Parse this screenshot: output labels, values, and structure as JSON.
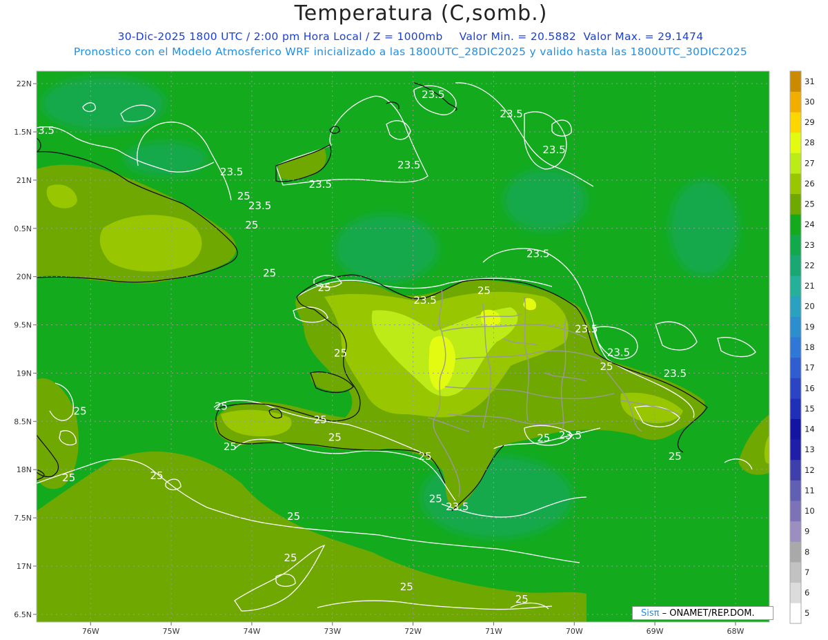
{
  "title": "Temperatura (C,somb.)",
  "subtitle": {
    "datetime": "30-Dic-2025  1800 UTC / 2:00 pm Hora Local / Z = 1000mb",
    "min": "Valor Min. = 20.5882",
    "max": "Valor Max. = 29.1474"
  },
  "subtitle2": "Pronostico con el Modelo Atmosferico WRF inicializado a las 1800UTC_28DIC2025 y valido hasta las  1800UTC_30DIC2025",
  "credit": {
    "brand": "Sisπ",
    "text": " – ONAMET/REP.DOM."
  },
  "map": {
    "lon_range": [
      -76.67,
      -67.58
    ],
    "lat_range": [
      16.42,
      22.13
    ],
    "lat_ticks": [
      {
        "v": 22.0,
        "label": "22N"
      },
      {
        "v": 21.5,
        "label": "1.5N"
      },
      {
        "v": 21.0,
        "label": "21N"
      },
      {
        "v": 20.5,
        "label": "0.5N"
      },
      {
        "v": 20.0,
        "label": "20N"
      },
      {
        "v": 19.5,
        "label": "9.5N"
      },
      {
        "v": 19.0,
        "label": "19N"
      },
      {
        "v": 18.5,
        "label": "8.5N"
      },
      {
        "v": 18.0,
        "label": "18N"
      },
      {
        "v": 17.5,
        "label": "7.5N"
      },
      {
        "v": 17.0,
        "label": "17N"
      },
      {
        "v": 16.5,
        "label": "6.5N"
      }
    ],
    "lon_ticks": [
      {
        "v": -76,
        "label": "76W"
      },
      {
        "v": -75,
        "label": "75W"
      },
      {
        "v": -74,
        "label": "74W"
      },
      {
        "v": -73,
        "label": "73W"
      },
      {
        "v": -72,
        "label": "72W"
      },
      {
        "v": -71,
        "label": "71W"
      },
      {
        "v": -70,
        "label": "70W"
      },
      {
        "v": -69,
        "label": "69W"
      },
      {
        "v": -68,
        "label": "68W"
      }
    ],
    "contour_labels": [
      {
        "lon": -76.55,
        "lat": 21.48,
        "t": "3.5"
      },
      {
        "lon": -74.25,
        "lat": 21.05,
        "t": "23.5"
      },
      {
        "lon": -73.9,
        "lat": 20.7,
        "t": "23.5"
      },
      {
        "lon": -74.0,
        "lat": 20.5,
        "t": "25"
      },
      {
        "lon": -74.1,
        "lat": 20.8,
        "t": "25"
      },
      {
        "lon": -73.78,
        "lat": 20.0,
        "t": "25"
      },
      {
        "lon": -73.15,
        "lat": 20.92,
        "t": "23.5"
      },
      {
        "lon": -72.05,
        "lat": 21.12,
        "t": "23.5"
      },
      {
        "lon": -71.75,
        "lat": 21.85,
        "t": "23.5"
      },
      {
        "lon": -70.78,
        "lat": 21.65,
        "t": "23.5"
      },
      {
        "lon": -70.25,
        "lat": 21.28,
        "t": "23.5"
      },
      {
        "lon": -70.45,
        "lat": 20.2,
        "t": "23.5"
      },
      {
        "lon": -71.12,
        "lat": 19.82,
        "t": "25"
      },
      {
        "lon": -71.85,
        "lat": 19.72,
        "t": "23.5"
      },
      {
        "lon": -73.1,
        "lat": 19.85,
        "t": "25"
      },
      {
        "lon": -69.85,
        "lat": 19.42,
        "t": "23.5"
      },
      {
        "lon": -69.45,
        "lat": 19.18,
        "t": "23.5"
      },
      {
        "lon": -69.6,
        "lat": 19.03,
        "t": "25"
      },
      {
        "lon": -68.75,
        "lat": 18.96,
        "t": "23.5"
      },
      {
        "lon": -72.9,
        "lat": 19.17,
        "t": "25"
      },
      {
        "lon": -74.38,
        "lat": 18.62,
        "t": "25"
      },
      {
        "lon": -76.13,
        "lat": 18.57,
        "t": "25"
      },
      {
        "lon": -73.15,
        "lat": 18.48,
        "t": "25"
      },
      {
        "lon": -72.97,
        "lat": 18.3,
        "t": "25"
      },
      {
        "lon": -74.27,
        "lat": 18.2,
        "t": "25"
      },
      {
        "lon": -71.85,
        "lat": 18.1,
        "t": "25"
      },
      {
        "lon": -70.38,
        "lat": 18.29,
        "t": "25"
      },
      {
        "lon": -70.05,
        "lat": 18.32,
        "t": "23.5"
      },
      {
        "lon": -68.75,
        "lat": 18.1,
        "t": "25"
      },
      {
        "lon": -76.27,
        "lat": 17.88,
        "t": "25"
      },
      {
        "lon": -75.18,
        "lat": 17.9,
        "t": "25"
      },
      {
        "lon": -71.72,
        "lat": 17.66,
        "t": "25"
      },
      {
        "lon": -71.45,
        "lat": 17.58,
        "t": "23.5"
      },
      {
        "lon": -73.48,
        "lat": 17.48,
        "t": "25"
      },
      {
        "lon": -73.52,
        "lat": 17.05,
        "t": "25"
      },
      {
        "lon": -72.08,
        "lat": 16.75,
        "t": "25"
      },
      {
        "lon": -70.65,
        "lat": 16.62,
        "t": "25"
      }
    ]
  },
  "colorbar": {
    "labels": [
      "5",
      "6",
      "7",
      "8",
      "9",
      "10",
      "11",
      "12",
      "13",
      "14",
      "15",
      "16",
      "17",
      "18",
      "19",
      "20",
      "21",
      "22",
      "23",
      "24",
      "25",
      "26",
      "27",
      "28",
      "29",
      "30",
      "31"
    ],
    "colors": [
      "#ffffff",
      "#dcdcdc",
      "#c2c2c2",
      "#a9a9a9",
      "#9c8ec0",
      "#7b72b8",
      "#5f5fb3",
      "#3e3ead",
      "#1e1ea8",
      "#1414a2",
      "#1f2fb8",
      "#2a44c4",
      "#2f5ed0",
      "#2f78d6",
      "#2c8ecf",
      "#2aa1c0",
      "#25b09a",
      "#19a774",
      "#12a94c",
      "#13aa1e",
      "#6fa800",
      "#98c600",
      "#bceb18",
      "#e2fb10",
      "#fdd600",
      "#f1ad00",
      "#cc8a00"
    ]
  },
  "colors": {
    "ocean": "#13aa1e",
    "ocean_cool": "#12a94c",
    "land": "#6fa800",
    "land_warm": "#98c600",
    "land_hot": "#bceb18",
    "land_max": "#e2fb10",
    "contour": "#ffffff",
    "coast": "#111111",
    "border": "#999999"
  }
}
